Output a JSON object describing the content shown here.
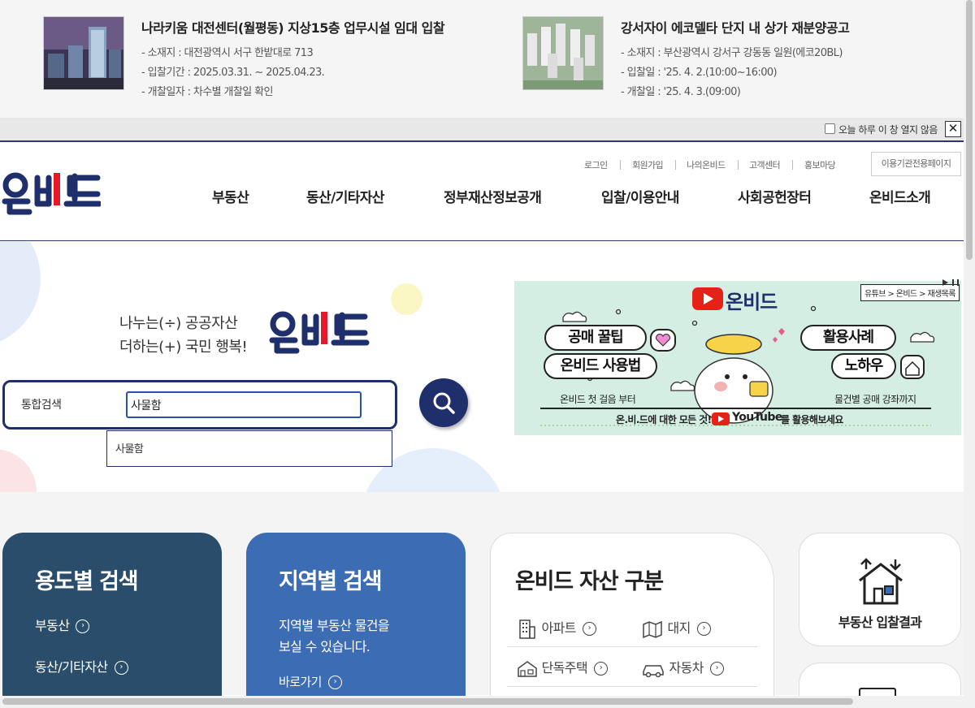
{
  "notice": {
    "items": [
      {
        "title": "나라키움 대전센터(월평동) 지상15층 업무시설 임대 입찰",
        "lines": [
          "- 소재지 : 대전광역시 서구 한밭대로 713",
          "- 입찰기간 : 2025.03.31. ~ 2025.04.23.",
          "- 개찰일자 : 차수별 개찰일 확인"
        ]
      },
      {
        "title": "강서자이 에코델타 단지 내 상가 재분양공고",
        "lines": [
          "- 소재지 : 부산광역시 강서구 강동동 일원(에코20BL)",
          "- 입찰일 : '25. 4. 2.(10:00~16:00)",
          "- 개찰일 : '25. 4. 3.(09:00)"
        ]
      }
    ],
    "dismiss_label": "오늘 하루 이 창 열지 않음",
    "close_label": "✕"
  },
  "header": {
    "logo_text": "온비드",
    "util_links": [
      "로그인",
      "회원가입",
      "나의온비드",
      "고객센터",
      "홍보마당"
    ],
    "portal_label": "이용기관전용페이지",
    "nav": [
      "부동산",
      "동산/기타자산",
      "정부재산정보공개",
      "입찰/이용안내",
      "사회공헌장터",
      "온비드소개"
    ]
  },
  "hero": {
    "slogan_line1": "나누는(÷) 공공자산",
    "slogan_line2": "더하는(+) 국민 행복!",
    "search_label": "통합검색",
    "search_value": "사물함",
    "autocomplete": [
      "사물함"
    ]
  },
  "banner": {
    "path": "유튜브 > 온비드 > 재생목록",
    "brand": "온비드",
    "pills": [
      "공매 꿀팁",
      "온비드 사용법",
      "활용사례",
      "노하우"
    ],
    "left_caption": "온비드 첫 걸음 부터",
    "right_caption": "물건별 공매 강좌까지",
    "footer_prefix": "온.비.드에 대한 모든 것!",
    "footer_brand": "YouTube",
    "footer_suffix": "를 활용해보세요"
  },
  "cards": {
    "usage": {
      "title": "용도별 검색",
      "links": [
        "부동산",
        "동산/기타자산"
      ]
    },
    "region": {
      "title": "지역별 검색",
      "desc1": "지역별 부동산 물건을",
      "desc2": "보실 수 있습니다.",
      "link": "바로가기"
    },
    "asset": {
      "title": "온비드 자산 구분",
      "items": [
        "아파트",
        "대지",
        "단독주택",
        "자동차"
      ]
    },
    "result": {
      "label": "부동산 입찰결과"
    }
  },
  "colors": {
    "navy": "#1f2f6b",
    "card_dark": "#2a4d6b",
    "card_blue": "#3b6cb4"
  }
}
